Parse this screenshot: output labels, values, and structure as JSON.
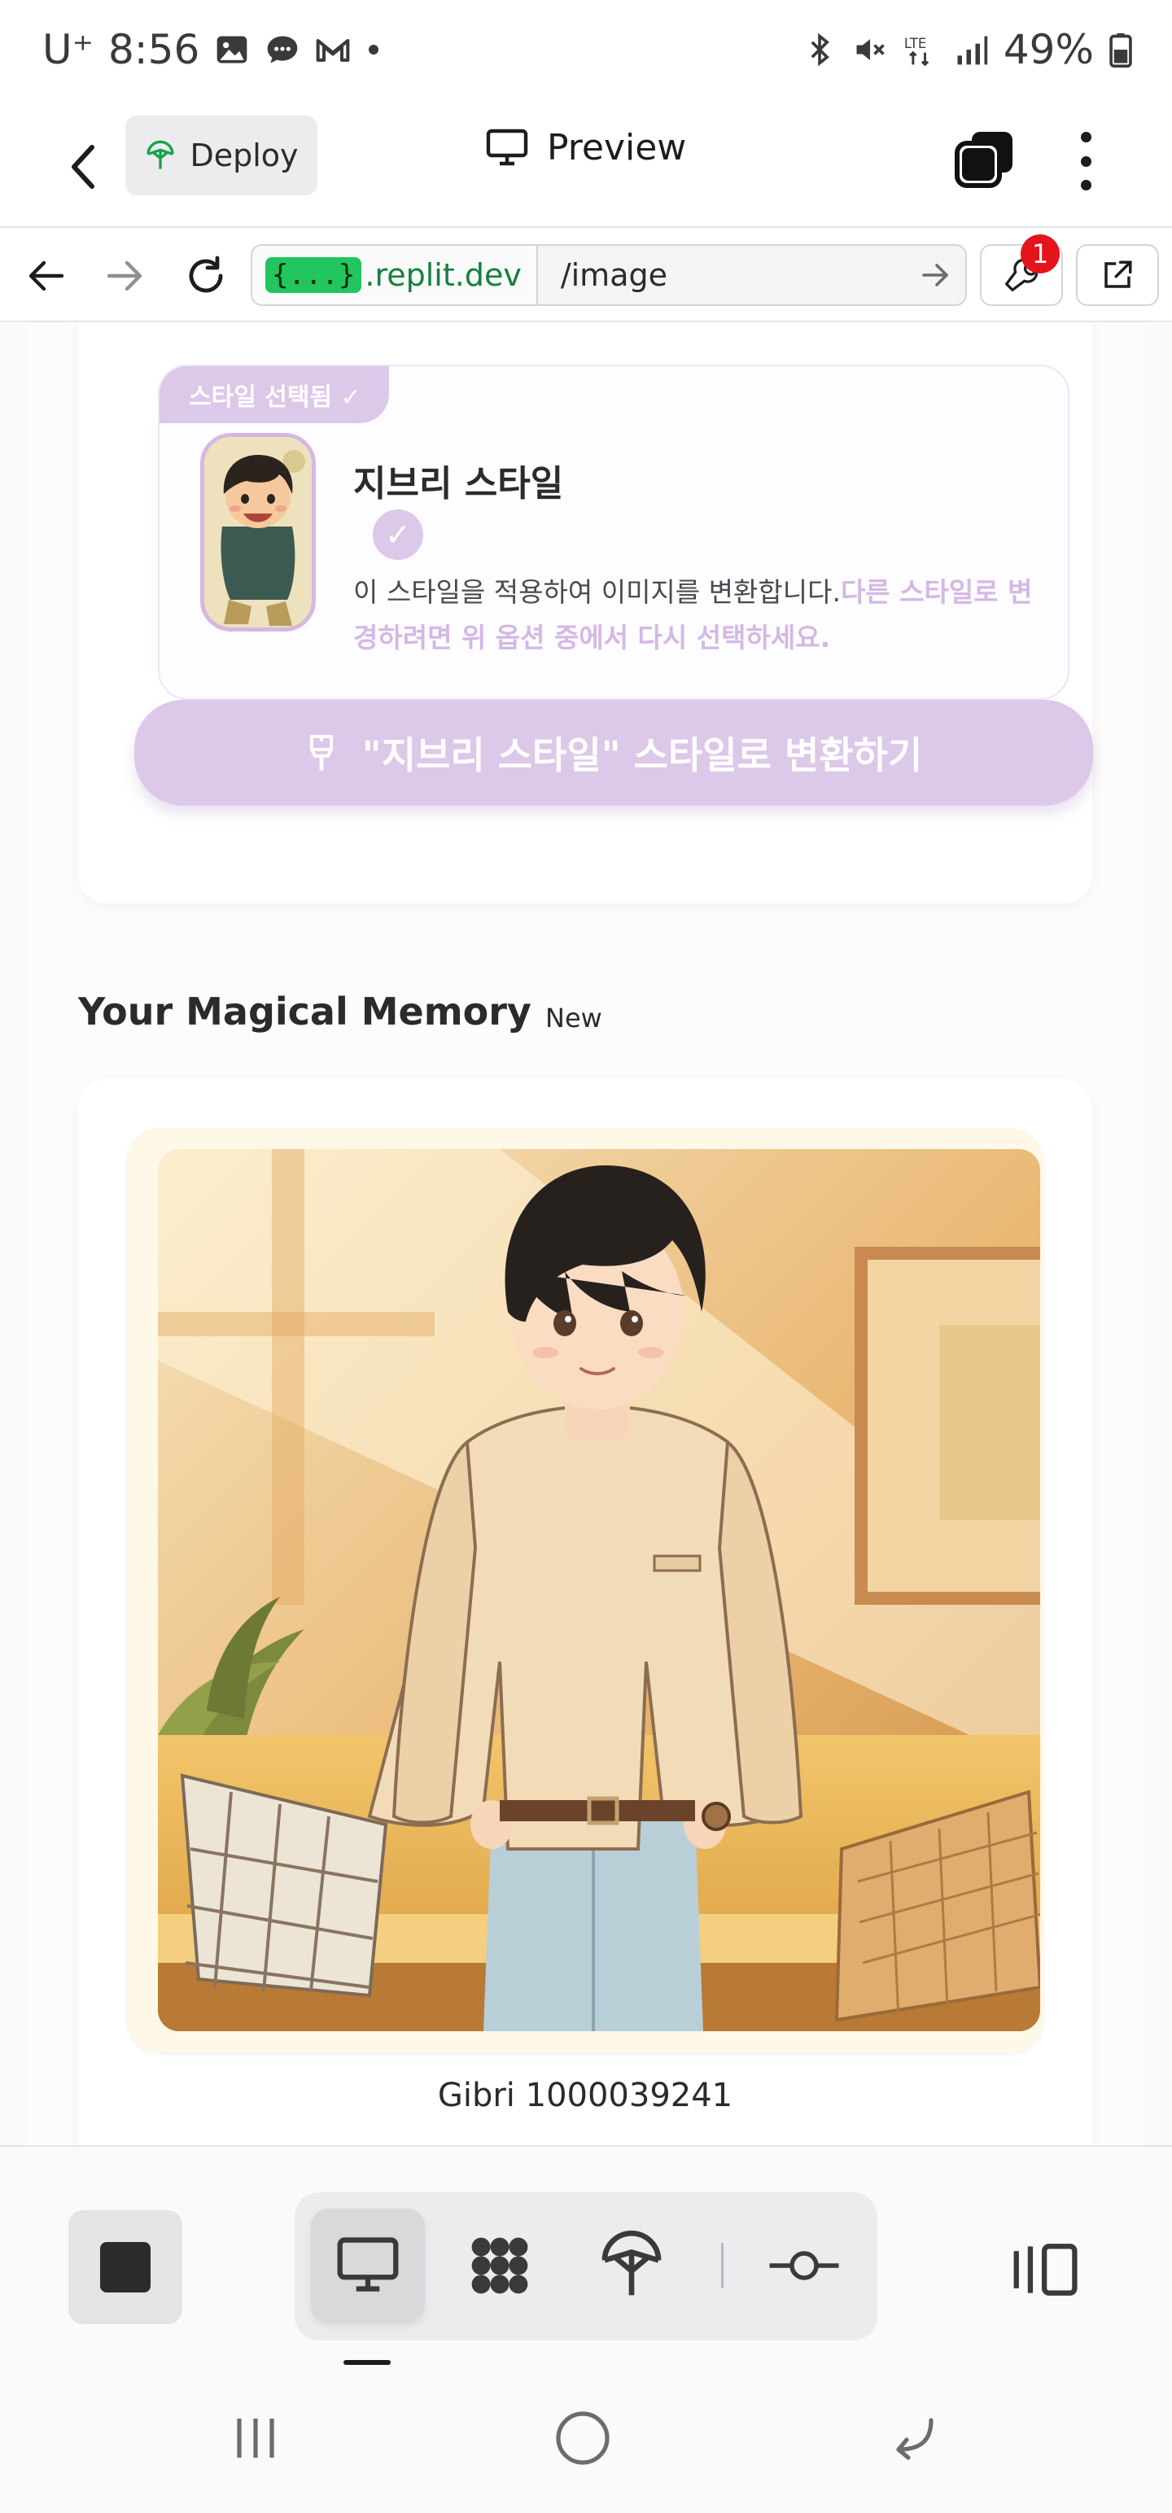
{
  "status_bar": {
    "carrier": "U⁺",
    "time": "8:56",
    "battery": "49%",
    "left_icons": [
      "gallery-icon",
      "chat-icon",
      "gmail-icon",
      "dot-icon"
    ],
    "right_icons": [
      "bluetooth-icon",
      "mute-icon",
      "lte-icon",
      "signal-icon",
      "battery-icon"
    ]
  },
  "header": {
    "deploy_label": "Deploy",
    "preview_label": "Preview"
  },
  "url_bar": {
    "domain_token": "{...}",
    "domain_suffix": ".replit.dev",
    "path": "/image",
    "devtools_badge": "1"
  },
  "style_card": {
    "selected_tag": "스타일 선택됨 ✓",
    "title": "지브리 스타일",
    "check": "✓",
    "description_plain": "이 스타일을 적용하여 이미지를 변환합니다.",
    "description_accent": "다른 스타일로 변경하려면 위 옵션 중에서 다시 선택하세요.",
    "convert_button": "\"지브리 스타일\" 스타일로 변환하기"
  },
  "memory": {
    "heading": "Your Magical Memory",
    "badge": "New",
    "name": "Gibri 1000039241"
  },
  "colors": {
    "accent_lavender": "#dcc8e8",
    "accent_text": "#d4b8e4",
    "url_green": "#22c55e",
    "badge_red": "#e5141b"
  }
}
